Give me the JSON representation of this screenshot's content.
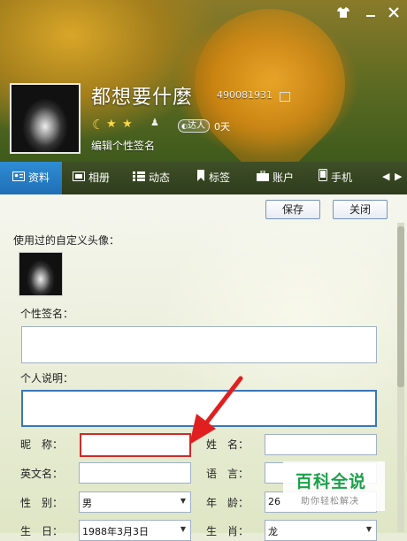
{
  "header": {
    "nickname": "都想要什麼",
    "qq_number": "490081931",
    "level_icons": [
      "moon-icon",
      "star-icon",
      "star-icon"
    ],
    "daren_badge": "达人",
    "days": "0天",
    "signature_edit": "编辑个性签名",
    "title_buttons": [
      "shirt-icon",
      "minimize-icon",
      "close-icon"
    ]
  },
  "tabs": [
    {
      "label": "资料",
      "icon": "id-card-icon",
      "active": true
    },
    {
      "label": "相册",
      "icon": "photo-icon"
    },
    {
      "label": "动态",
      "icon": "list-icon"
    },
    {
      "label": "标签",
      "icon": "bookmark-icon"
    },
    {
      "label": "账户",
      "icon": "briefcase-icon"
    },
    {
      "label": "手机",
      "icon": "phone-icon"
    }
  ],
  "toolbar": {
    "save_label": "保存",
    "close_label": "关闭"
  },
  "form": {
    "custom_avatar_label": "使用过的自定义头像：",
    "signature_label": "个性签名：",
    "description_label": "个人说明：",
    "nickname_label": "昵　称：",
    "surname_label": "姓　名：",
    "english_name_label": "英文名：",
    "language_label": "语　言：",
    "gender_label": "性　别：",
    "gender_value": "男",
    "age_label": "年　龄：",
    "age_value": "26",
    "birthday_label": "生　日：",
    "birthday_value": "1988年3月3日",
    "zodiac_label": "生　肖：",
    "zodiac_value": "龙"
  },
  "watermark": {
    "title": "百科全说",
    "subtitle": "助你轻松解决"
  },
  "colors": {
    "tab_active": "#2f8cd3",
    "highlight_red": "#cf2a2a",
    "focus_blue": "#3a76b8"
  }
}
